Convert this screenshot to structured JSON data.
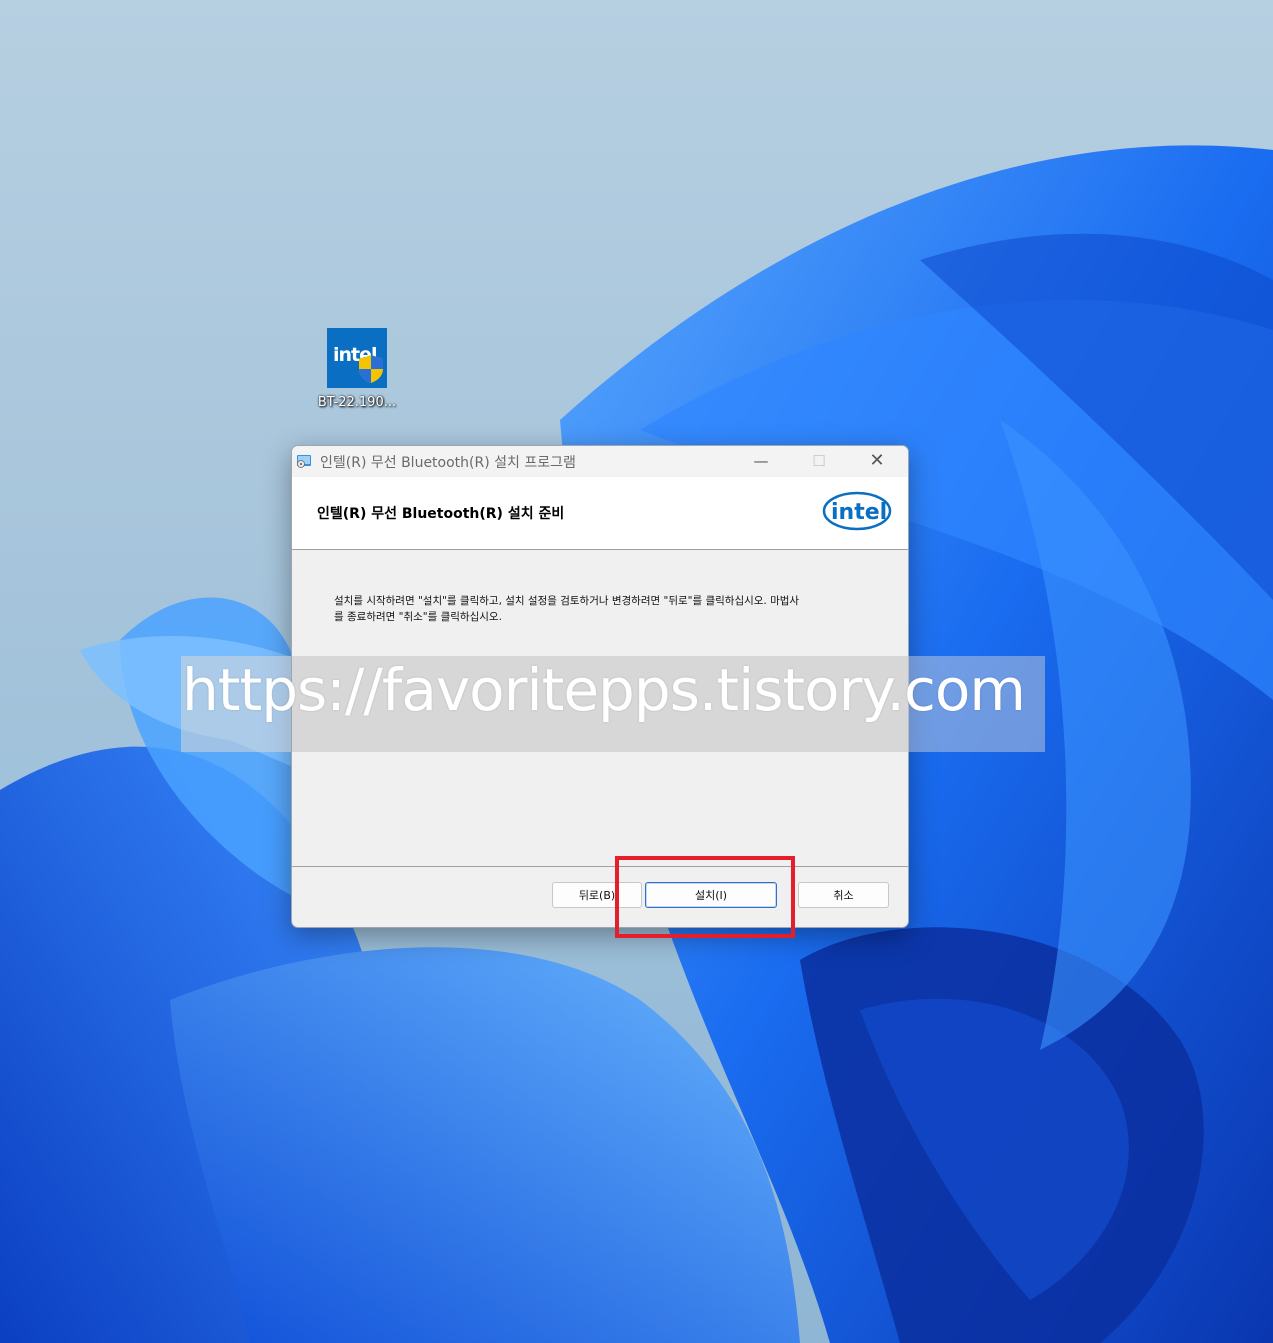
{
  "desktop": {
    "icon": {
      "brand": "intel",
      "label": "BT-22.190..."
    }
  },
  "window": {
    "title": "인텔(R) 무선 Bluetooth(R) 설치 프로그램",
    "controls": {
      "minimize": "—",
      "maximize": "☐",
      "close": "✕"
    },
    "heading": "인텔(R) 무선 Bluetooth(R) 설치 준비",
    "logo_text": "intel",
    "body_lines": [
      "설치를 시작하려면 \"설치\"를 클릭하고, 설치 설정을 검토하거나 변경하려면 \"뒤로\"를 클릭하십시오. 마법사",
      "를 종료하려면 \"취소\"를 클릭하십시오."
    ],
    "buttons": {
      "back": "뒤로(B)",
      "install": "설치(I)",
      "cancel": "취소"
    }
  },
  "watermark": "https://favoritepps.tistory.com",
  "colors": {
    "highlight": "#e41e2a",
    "intel_blue": "#0a6fc2",
    "wallpaper_blue": "#1565e0"
  }
}
